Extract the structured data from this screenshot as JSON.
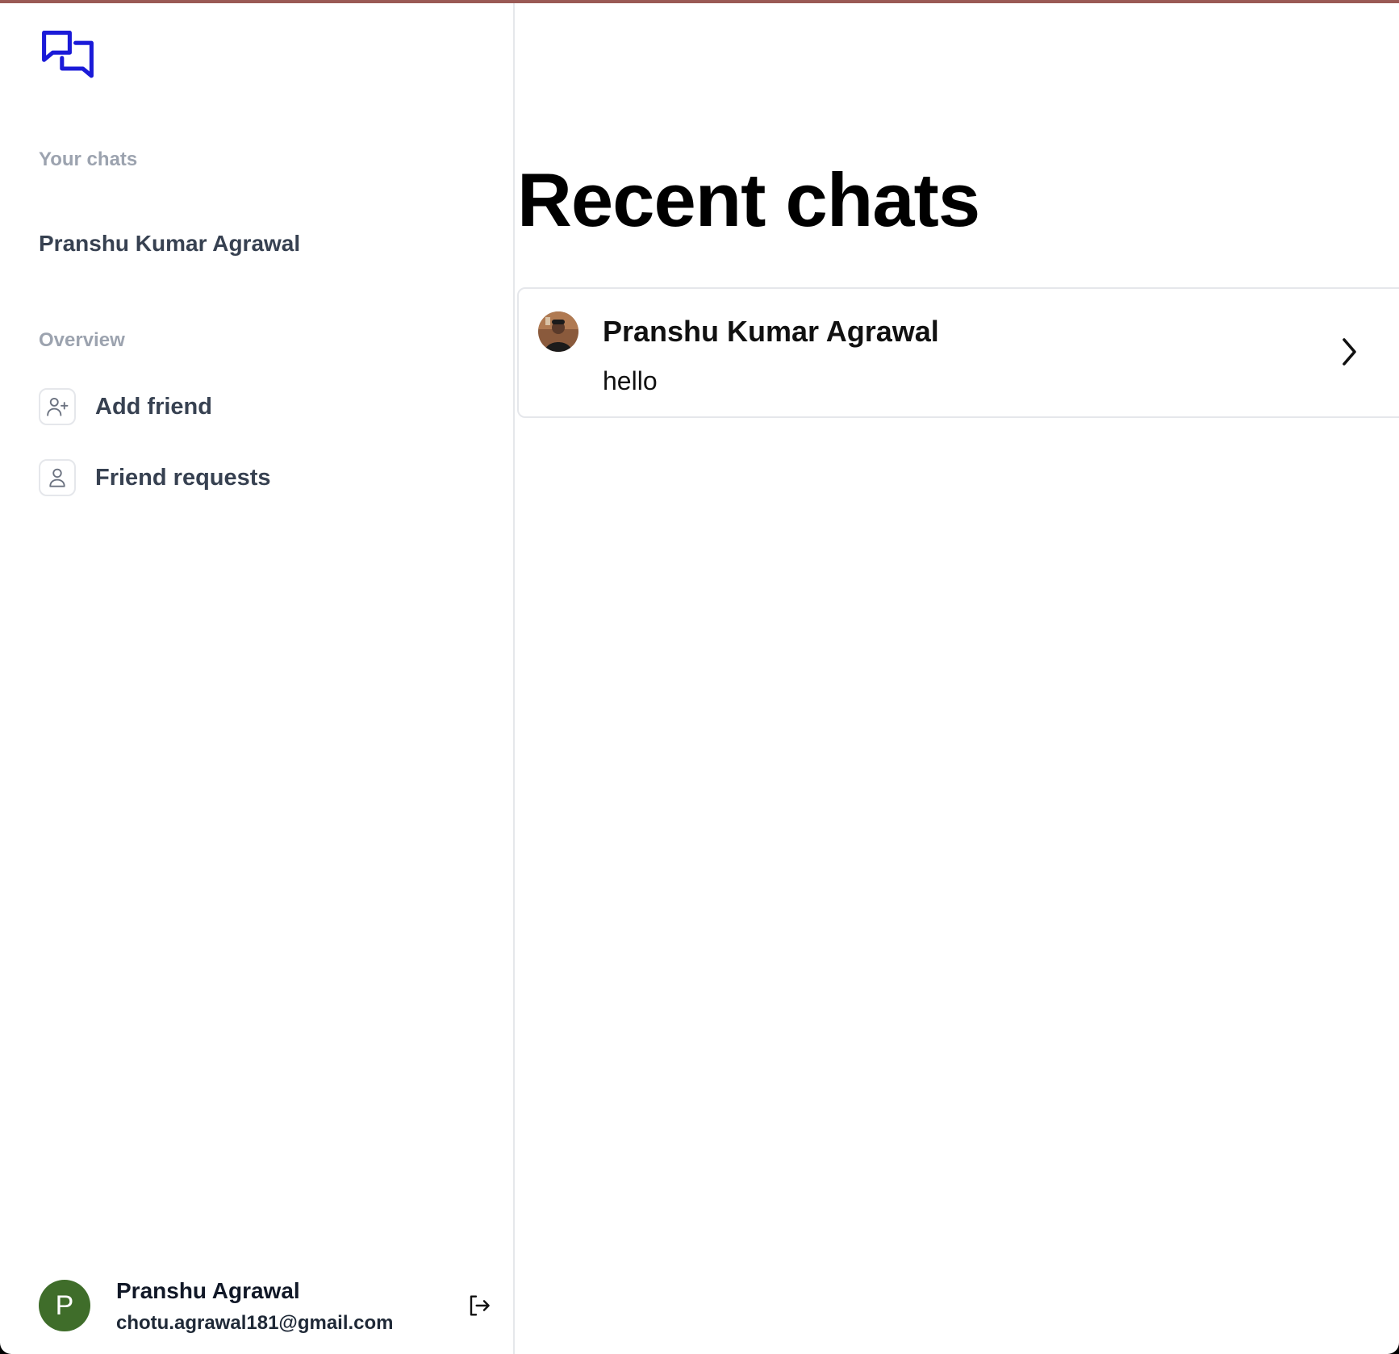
{
  "sidebar": {
    "logo_icon": "chat-bubbles-icon",
    "your_chats_label": "Your chats",
    "chats": [
      {
        "name": "Pranshu Kumar Agrawal"
      }
    ],
    "overview_label": "Overview",
    "nav": [
      {
        "label": "Add friend",
        "icon": "user-plus-icon"
      },
      {
        "label": "Friend requests",
        "icon": "user-icon"
      }
    ],
    "user": {
      "initial": "P",
      "name": "Pranshu Agrawal",
      "email": "chotu.agrawal181@gmail.com",
      "avatar_color": "#3f6d2a",
      "signout_icon": "sign-out-icon"
    }
  },
  "main": {
    "title": "Recent chats",
    "recent": [
      {
        "name": "Pranshu Kumar Agrawal",
        "last_message": "hello",
        "chevron_icon": "chevron-right-icon"
      }
    ]
  },
  "colors": {
    "brand": "#1a1ad8",
    "muted": "#9ca3af",
    "text": "#374151",
    "border": "#e5e7eb",
    "window_top_bar": "#9a5a55"
  }
}
